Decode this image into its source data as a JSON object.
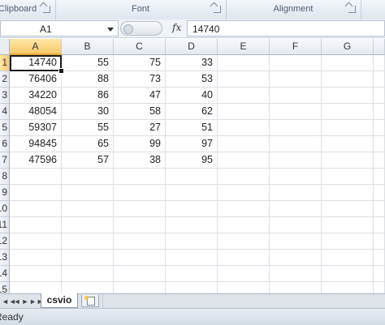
{
  "ribbon": {
    "groups": [
      {
        "label": "Clipboard"
      },
      {
        "label": "Font"
      },
      {
        "label": "Alignment"
      }
    ]
  },
  "formula_bar": {
    "name_box": "A1",
    "fx_label": "fx",
    "content": "14740"
  },
  "grid": {
    "columns": [
      "A",
      "B",
      "C",
      "D",
      "E",
      "F",
      "G"
    ],
    "rows": [
      "1",
      "2",
      "3",
      "4",
      "5",
      "6",
      "7",
      "8",
      "9",
      "10",
      "11",
      "12",
      "13",
      "14",
      "15"
    ],
    "cells": [
      [
        "14740",
        "55",
        "75",
        "33"
      ],
      [
        "76406",
        "88",
        "73",
        "53"
      ],
      [
        "34220",
        "86",
        "47",
        "40"
      ],
      [
        "48054",
        "30",
        "58",
        "62"
      ],
      [
        "59307",
        "55",
        "27",
        "51"
      ],
      [
        "94845",
        "65",
        "99",
        "97"
      ],
      [
        "47596",
        "57",
        "38",
        "95"
      ]
    ],
    "active_cell": "A1"
  },
  "sheets": {
    "tabs": [
      {
        "label": "csvio"
      }
    ],
    "nav": [
      "◄◄",
      "◄",
      "►",
      "►►"
    ]
  },
  "status": {
    "text": "Ready"
  },
  "colors": {
    "selected_header": "#f8c96a",
    "active_border": "#1a1a1a",
    "gridline": "#dadfe6"
  }
}
